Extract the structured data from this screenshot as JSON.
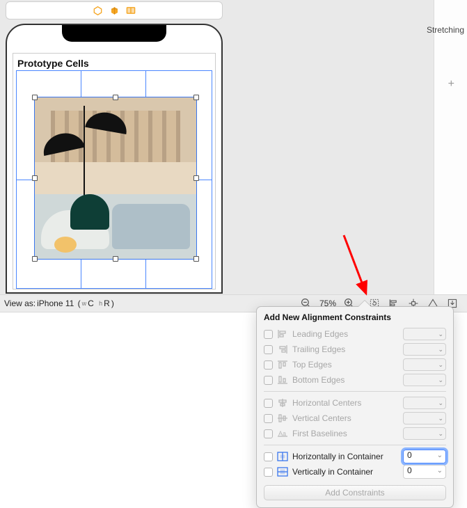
{
  "breadcrumb": {
    "icons": [
      "hex-orange",
      "cube-orange",
      "storyboard-orange"
    ]
  },
  "device": {
    "section_title": "Prototype Cells"
  },
  "inspector": {
    "label": "Stretching",
    "add_glyph": "+"
  },
  "status": {
    "view_as_prefix": "View as: ",
    "device_name": "iPhone 11",
    "trait1_sub": "w",
    "trait1": "C",
    "trait2_sub": "h",
    "trait2": "R",
    "zoom": "75%"
  },
  "popover": {
    "title": "Add New Alignment Constraints",
    "rows": [
      {
        "key": "leading",
        "label": "Leading Edges",
        "value": "",
        "enabled": false
      },
      {
        "key": "trailing",
        "label": "Trailing Edges",
        "value": "",
        "enabled": false
      },
      {
        "key": "top",
        "label": "Top Edges",
        "value": "",
        "enabled": false
      },
      {
        "key": "bottom",
        "label": "Bottom Edges",
        "value": "",
        "enabled": false
      }
    ],
    "rows2": [
      {
        "key": "hcenters",
        "label": "Horizontal Centers",
        "value": "",
        "enabled": false
      },
      {
        "key": "vcenters",
        "label": "Vertical Centers",
        "value": "",
        "enabled": false
      },
      {
        "key": "baselines",
        "label": "First Baselines",
        "value": "",
        "enabled": false
      }
    ],
    "rows3": [
      {
        "key": "hcontainer",
        "label": "Horizontally in Container",
        "value": "0",
        "enabled": true,
        "focused": true
      },
      {
        "key": "vcontainer",
        "label": "Vertically in Container",
        "value": "0",
        "enabled": true,
        "focused": false
      }
    ],
    "button": "Add Constraints"
  },
  "icons": {
    "zoom_out": "−",
    "zoom_in": "+",
    "status_buttons": [
      "update-frames",
      "align",
      "pin",
      "resolve",
      "embed"
    ]
  },
  "colors": {
    "accent": "#4a86ff",
    "arrow": "#ff0000"
  }
}
